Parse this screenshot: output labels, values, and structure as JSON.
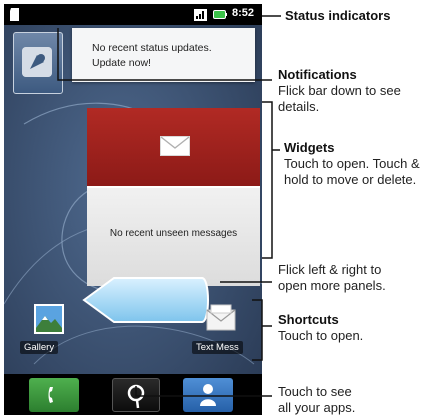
{
  "status_bar": {
    "time": "8:52"
  },
  "status_widget": {
    "line1": "No recent status updates.",
    "line2": "Update now!"
  },
  "messages_widget": {
    "empty_text": "No recent unseen messages"
  },
  "shortcuts": [
    {
      "label": "Gallery"
    },
    {
      "label": "Text Mess"
    }
  ],
  "callouts": {
    "status": {
      "title": "Status indicators"
    },
    "notifications": {
      "title": "Notifications",
      "line1": "Flick bar down to see",
      "line2": "details."
    },
    "widgets": {
      "title": "Widgets",
      "line1": "Touch to open. Touch &",
      "line2": "hold to move or delete."
    },
    "panels": {
      "line1": "Flick left & right to",
      "line2": "open more panels."
    },
    "shortcuts": {
      "title": "Shortcuts",
      "line1": "Touch to open."
    },
    "apps": {
      "line1": "Touch to see",
      "line2": "all your apps."
    }
  },
  "icons": [
    "sd-card-icon",
    "signal-icon",
    "battery-icon",
    "status-bubble-icon",
    "envelope-icon",
    "gallery-icon",
    "text-message-icon",
    "phone-icon",
    "apps-search-icon",
    "contacts-icon"
  ]
}
